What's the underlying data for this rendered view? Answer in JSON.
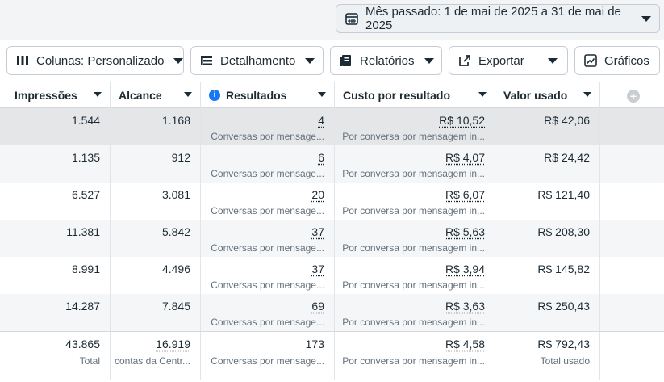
{
  "date_picker": {
    "label": "Mês passado: 1 de mai de 2025 a 31 de mai de 2025"
  },
  "toolbar": {
    "columns_label": "Colunas: Personalizado",
    "breakdown_label": "Detalhamento",
    "reports_label": "Relatórios",
    "export_label": "Exportar",
    "charts_label": "Gráficos"
  },
  "table": {
    "headers": {
      "impressions": "Impressões",
      "reach": "Alcance",
      "results": "Resultados",
      "cost_per_result": "Custo por resultado",
      "amount_spent": "Valor usado"
    },
    "rows": [
      {
        "impressions": "1.544",
        "reach": "1.168",
        "results": "4",
        "results_sub": "Conversas por mensage...",
        "cost": "R$ 10,52",
        "cost_sub": "Por conversa por mensagem in...",
        "spent": "R$ 42,06"
      },
      {
        "impressions": "1.135",
        "reach": "912",
        "results": "6",
        "results_sub": "Conversas por mensage...",
        "cost": "R$ 4,07",
        "cost_sub": "Por conversa por mensagem in...",
        "spent": "R$ 24,42"
      },
      {
        "impressions": "6.527",
        "reach": "3.081",
        "results": "20",
        "results_sub": "Conversas por mensage...",
        "cost": "R$ 6,07",
        "cost_sub": "Por conversa por mensagem in...",
        "spent": "R$ 121,40"
      },
      {
        "impressions": "11.381",
        "reach": "5.842",
        "results": "37",
        "results_sub": "Conversas por mensage...",
        "cost": "R$ 5,63",
        "cost_sub": "Por conversa por mensagem in...",
        "spent": "R$ 208,30"
      },
      {
        "impressions": "8.991",
        "reach": "4.496",
        "results": "37",
        "results_sub": "Conversas por mensage...",
        "cost": "R$ 3,94",
        "cost_sub": "Por conversa por mensagem in...",
        "spent": "R$ 145,82"
      },
      {
        "impressions": "14.287",
        "reach": "7.845",
        "results": "69",
        "results_sub": "Conversas por mensage...",
        "cost": "R$ 3,63",
        "cost_sub": "Por conversa por mensagem in...",
        "spent": "R$ 250,43"
      }
    ],
    "total": {
      "impressions": "43.865",
      "impressions_sub": "Total",
      "reach": "16.919",
      "reach_sub": "contas da Centr...",
      "results": "173",
      "results_sub": "Conversas por mensage...",
      "cost": "R$ 4,58",
      "cost_sub": "Por conversa por mensagem in...",
      "spent": "R$ 792,43",
      "spent_sub": "Total usado"
    }
  },
  "colors": {
    "accent": "#1877f2",
    "border": "#c5ccd3",
    "highlight_row": "#e4e6e8"
  }
}
